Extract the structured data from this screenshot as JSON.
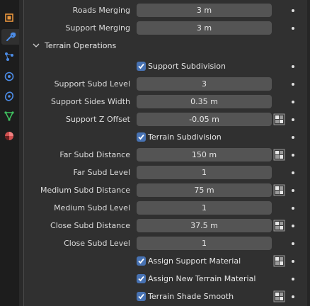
{
  "colors": {
    "accent": "#4772b3",
    "field_bg": "#545454",
    "panel_bg": "#303030",
    "sidebar_bg": "#1d1d1d"
  },
  "sidebar": {
    "icons": [
      "object-icon",
      "wrench-icon",
      "particles-icon",
      "physics-icon",
      "constraints-icon",
      "data-icon",
      "material-icon"
    ]
  },
  "rows": {
    "roads_merging": {
      "label": "Roads Merging",
      "value": "3 m"
    },
    "support_merging": {
      "label": "Support Merging",
      "value": "3 m"
    }
  },
  "section": {
    "title": "Terrain Operations"
  },
  "terrain": {
    "support_subdivision": {
      "label": "Support Subdivision",
      "checked": true
    },
    "support_subd_level": {
      "label": "Support Subd Level",
      "value": "3"
    },
    "support_sides_width": {
      "label": "Support Sides Width",
      "value": "0.35 m"
    },
    "support_z_offset": {
      "label": "Support Z Offset",
      "value": "-0.05 m"
    },
    "terrain_subdivision": {
      "label": "Terrain Subdivision",
      "checked": true
    },
    "far_subd_distance": {
      "label": "Far Subd Distance",
      "value": "150 m"
    },
    "far_subd_level": {
      "label": "Far Subd Level",
      "value": "1"
    },
    "medium_subd_distance": {
      "label": "Medium Subd Distance",
      "value": "75 m"
    },
    "medium_subd_level": {
      "label": "Medium Subd Level",
      "value": "1"
    },
    "close_subd_distance": {
      "label": "Close Subd Distance",
      "value": "37.5 m"
    },
    "close_subd_level": {
      "label": "Close Subd Level",
      "value": "1"
    },
    "assign_support_material": {
      "label": "Assign Support Material",
      "checked": true
    },
    "assign_new_terrain_material": {
      "label": "Assign New Terrain Material",
      "checked": true
    },
    "terrain_shade_smooth": {
      "label": "Terrain Shade Smooth",
      "checked": true
    }
  }
}
